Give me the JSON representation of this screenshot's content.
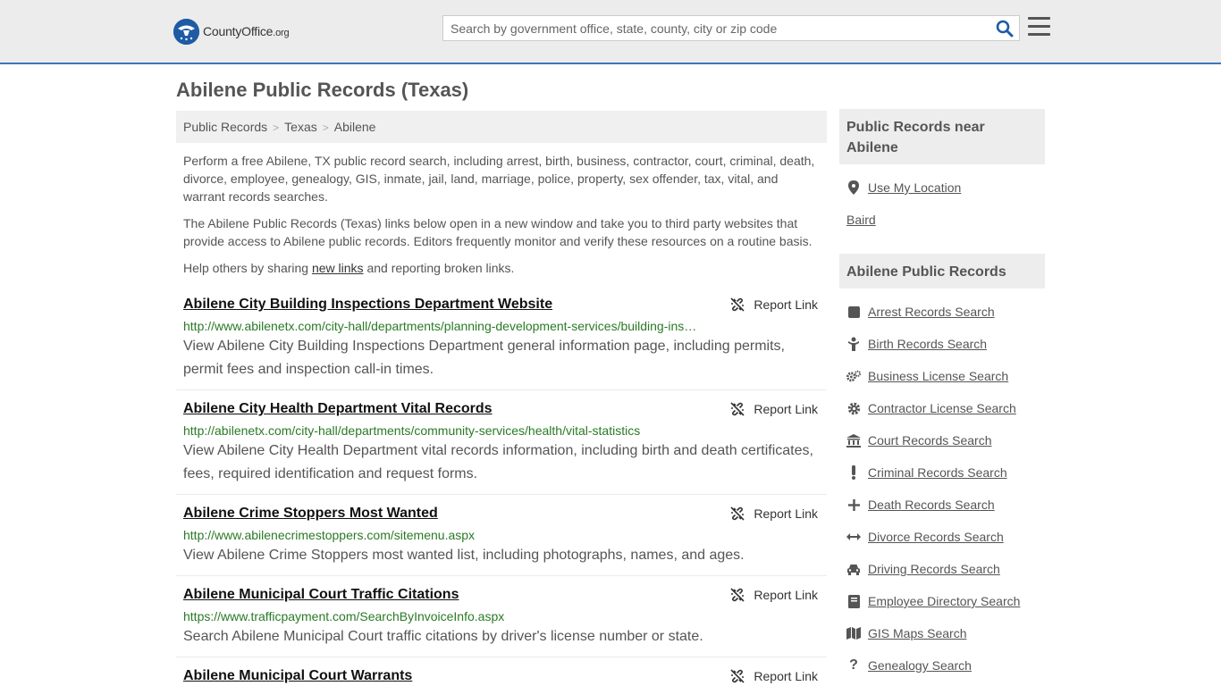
{
  "header": {
    "logo_main": "CountyOffice",
    "logo_suffix": ".org",
    "search_placeholder": "Search by government office, state, county, city or zip code"
  },
  "page_title": "Abilene Public Records (Texas)",
  "breadcrumb": [
    "Public Records",
    "Texas",
    "Abilene"
  ],
  "intro": {
    "p1": "Perform a free Abilene, TX public record search, including arrest, birth, business, contractor, court, criminal, death, divorce, employee, genealogy, GIS, inmate, jail, land, marriage, police, property, sex offender, tax, vital, and warrant records searches.",
    "p2": "The Abilene Public Records (Texas) links below open in a new window and take you to third party websites that provide access to Abilene public records. Editors frequently monitor and verify these resources on a routine basis.",
    "p3_before": "Help others by sharing ",
    "p3_link": "new links",
    "p3_after": " and reporting broken links."
  },
  "report_label": "Report Link",
  "results": [
    {
      "title": "Abilene City Building Inspections Department Website",
      "url": "http://www.abilenetx.com/city-hall/departments/planning-development-services/building-inspections",
      "desc": "View Abilene City Building Inspections Department general information page, including permits, permit fees and inspection call-in times."
    },
    {
      "title": "Abilene City Health Department Vital Records",
      "url": "http://abilenetx.com/city-hall/departments/community-services/health/vital-statistics",
      "desc": "View Abilene City Health Department vital records information, including birth and death certificates, fees, required identification and request forms."
    },
    {
      "title": "Abilene Crime Stoppers Most Wanted",
      "url": "http://www.abilenecrimestoppers.com/sitemenu.aspx",
      "desc": "View Abilene Crime Stoppers most wanted list, including photographs, names, and ages."
    },
    {
      "title": "Abilene Municipal Court Traffic Citations",
      "url": "https://www.trafficpayment.com/SearchByInvoiceInfo.aspx",
      "desc": "Search Abilene Municipal Court traffic citations by driver's license number or state."
    },
    {
      "title": "Abilene Municipal Court Warrants",
      "url": "",
      "desc": ""
    }
  ],
  "sidebar": {
    "near_heading": "Public Records near Abilene",
    "use_location": "Use My Location",
    "nearby": [
      "Baird"
    ],
    "records_heading": "Abilene Public Records",
    "links": [
      {
        "label": "Arrest Records Search",
        "icon": "square-icon"
      },
      {
        "label": "Birth Records Search",
        "icon": "baby-icon"
      },
      {
        "label": "Business License Search",
        "icon": "gears-icon"
      },
      {
        "label": "Contractor License Search",
        "icon": "gear-icon"
      },
      {
        "label": "Court Records Search",
        "icon": "courthouse-icon"
      },
      {
        "label": "Criminal Records Search",
        "icon": "exclamation-icon"
      },
      {
        "label": "Death Records Search",
        "icon": "cross-icon"
      },
      {
        "label": "Divorce Records Search",
        "icon": "arrows-horizontal-icon"
      },
      {
        "label": "Driving Records Search",
        "icon": "car-icon"
      },
      {
        "label": "Employee Directory Search",
        "icon": "book-icon"
      },
      {
        "label": "GIS Maps Search",
        "icon": "map-icon"
      },
      {
        "label": "Genealogy Search",
        "icon": "question-icon"
      }
    ]
  }
}
